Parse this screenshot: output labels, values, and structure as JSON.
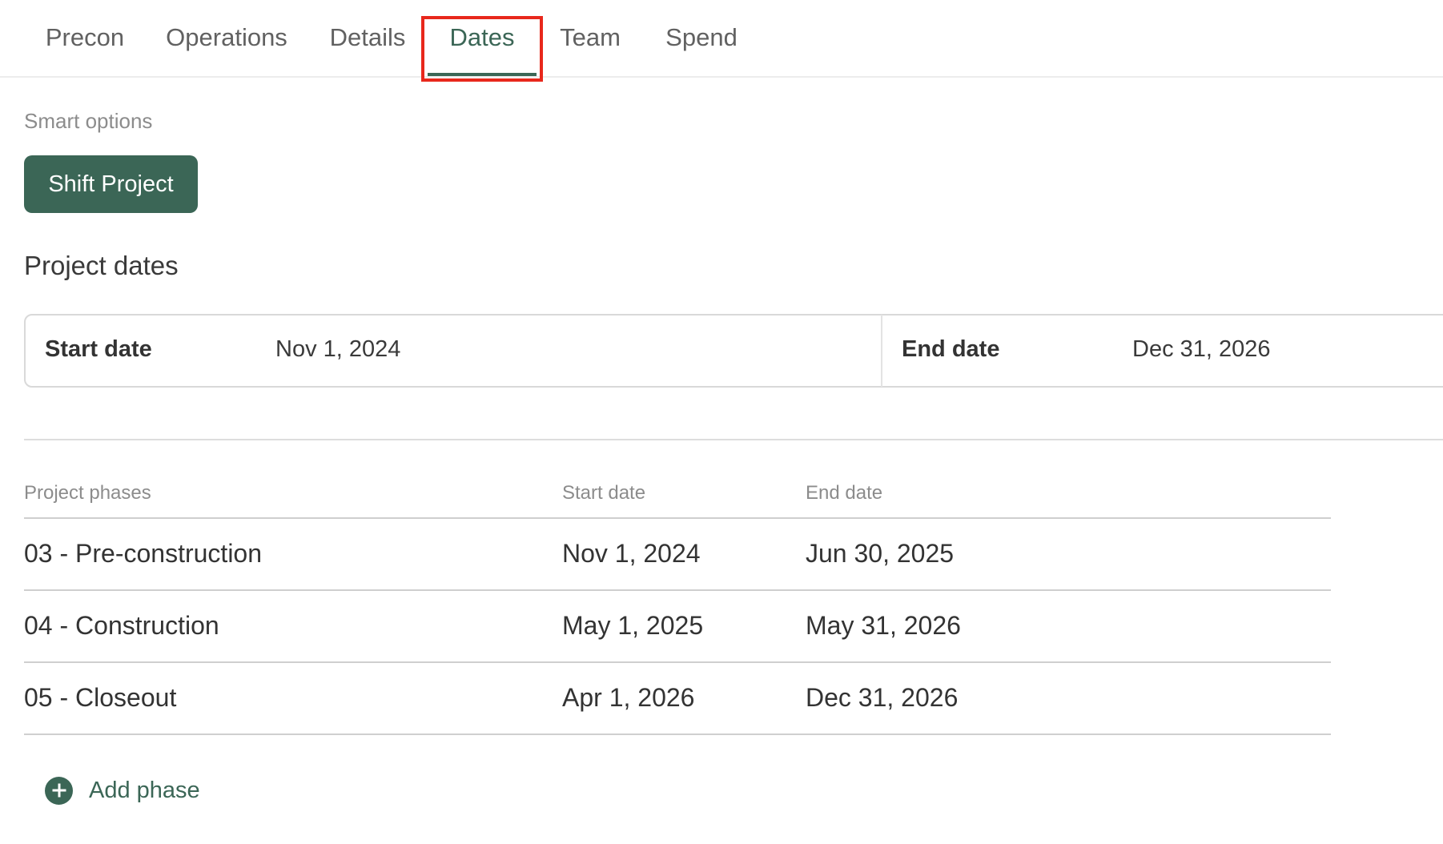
{
  "tabs": [
    {
      "label": "Precon",
      "active": false
    },
    {
      "label": "Operations",
      "active": false
    },
    {
      "label": "Details",
      "active": false
    },
    {
      "label": "Dates",
      "active": true
    },
    {
      "label": "Team",
      "active": false
    },
    {
      "label": "Spend",
      "active": false
    }
  ],
  "smart_options": {
    "label": "Smart options",
    "shift_button": "Shift Project"
  },
  "project_dates": {
    "heading": "Project dates",
    "start_label": "Start date",
    "start_value": "Nov 1, 2024",
    "end_label": "End date",
    "end_value": "Dec 31, 2026"
  },
  "phases": {
    "columns": [
      "Project phases",
      "Start date",
      "End date"
    ],
    "rows": [
      {
        "name": "03 - Pre-construction",
        "start": "Nov 1, 2024",
        "end": "Jun 30, 2025"
      },
      {
        "name": "04 - Construction",
        "start": "May 1, 2025",
        "end": "May 31, 2026"
      },
      {
        "name": "05 - Closeout",
        "start": "Apr 1, 2026",
        "end": "Dec 31, 2026"
      }
    ],
    "add_label": "Add phase"
  },
  "colors": {
    "accent": "#3b6656",
    "highlight": "#e8281c"
  },
  "icons": {
    "add_phase": "plus-circle-icon"
  }
}
